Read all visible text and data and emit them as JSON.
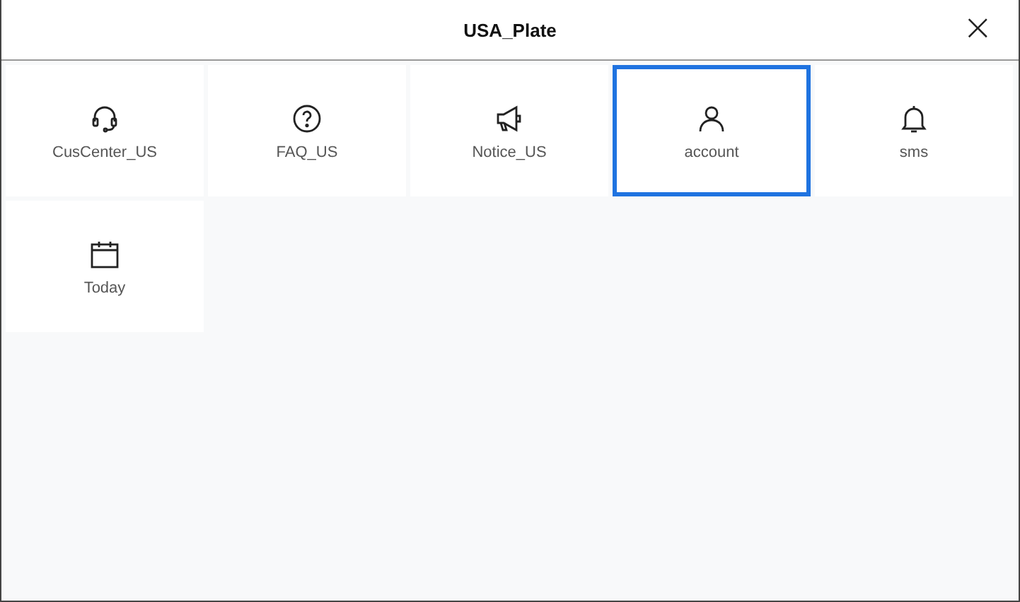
{
  "window": {
    "title": "USA_Plate",
    "close": "×"
  },
  "tiles": [
    {
      "label": "CusCenter_US",
      "selected": false
    },
    {
      "label": "FAQ_US",
      "selected": false
    },
    {
      "label": "Notice_US",
      "selected": false
    },
    {
      "label": "account",
      "selected": true
    },
    {
      "label": "sms",
      "selected": false
    },
    {
      "label": "Today",
      "selected": false
    }
  ]
}
